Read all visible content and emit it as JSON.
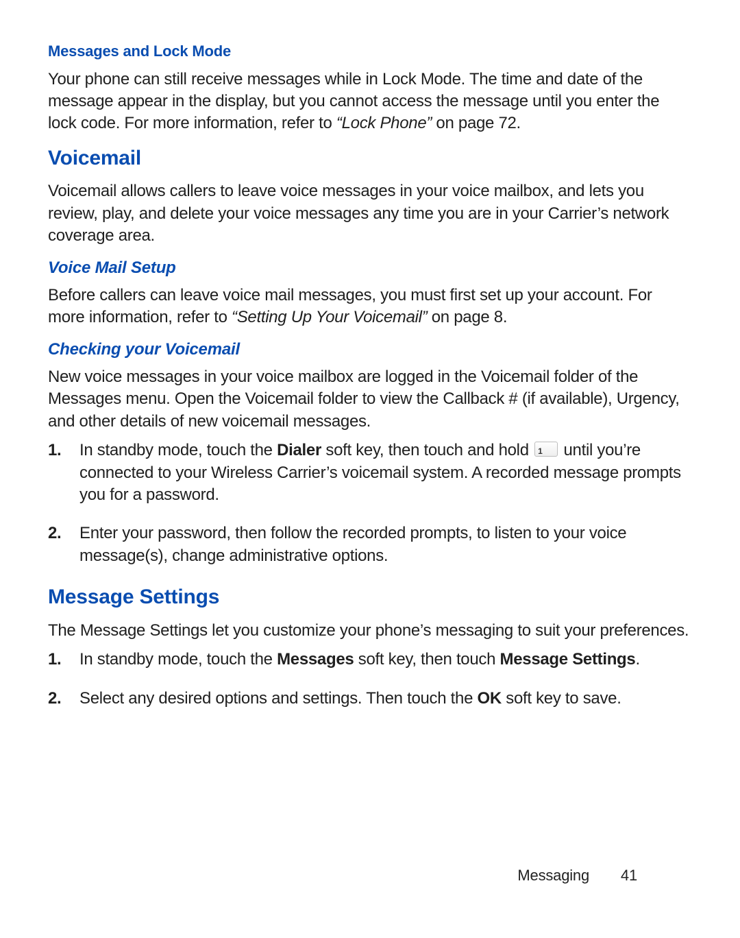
{
  "sec1": {
    "heading": "Messages and Lock Mode",
    "text_a": "Your phone can still receive messages while in Lock Mode. The time and date of the message appear in the display, but you cannot access the message until you enter the lock code. For more information, refer to ",
    "ref": "“Lock Phone”",
    "text_b": "  on page 72."
  },
  "sec2": {
    "heading": "Voicemail",
    "text": "Voicemail allows callers to leave voice messages in your voice mailbox, and lets you review, play, and delete your voice messages any time you are in your Carrier’s network coverage area."
  },
  "sec3": {
    "heading": "Voice Mail Setup",
    "text_a": "Before callers can leave voice mail messages, you must first set up your account. For more information, refer to ",
    "ref": "“Setting Up Your Voicemail”",
    "text_b": "  on page 8."
  },
  "sec4": {
    "heading": "Checking your Voicemail",
    "intro": "New voice messages in your voice mailbox are logged in the Voicemail folder of the Messages menu. Open the Voicemail folder to view the Callback # (if available), Urgency, and other details of new voicemail messages.",
    "steps": {
      "s1": {
        "num": "1.",
        "a": "In standby mode, touch the ",
        "bold1": "Dialer",
        "b": " soft key, then touch and hold ",
        "c": " until you’re connected to your Wireless Carrier’s voicemail system. A recorded message prompts you for a password."
      },
      "s2": {
        "num": "2.",
        "text": "Enter your password, then follow the recorded prompts, to listen to your voice message(s), change administrative options."
      }
    }
  },
  "sec5": {
    "heading": "Message Settings",
    "intro": "The Message Settings let you customize your phone’s messaging to suit your preferences.",
    "steps": {
      "s1": {
        "num": "1.",
        "a": "In standby mode, touch the ",
        "bold1": "Messages",
        "b": " soft key, then touch ",
        "bold2": "Message Settings",
        "c": "."
      },
      "s2": {
        "num": "2.",
        "a": "Select any desired options and settings. Then touch the ",
        "bold1": "OK",
        "b": " soft key to save."
      }
    }
  },
  "key1": {
    "main": "1",
    "sub": ""
  },
  "footer": {
    "label": "Messaging",
    "page": "41"
  }
}
